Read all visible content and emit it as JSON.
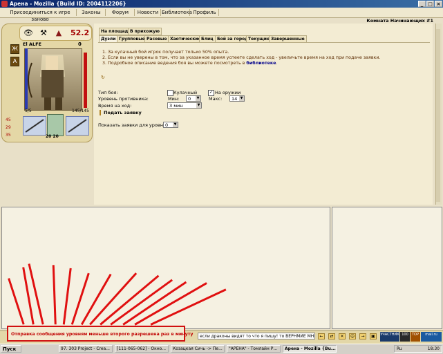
{
  "window": {
    "title": "Арена - Mozilla {Build ID: 2004112206}",
    "min_icon": "minimize-icon",
    "max_icon": "maximize-icon",
    "close_icon": "close-icon"
  },
  "menu": {
    "items": [
      "Присоединиться к игре заново",
      "Законы",
      "Форум",
      "Новости",
      "Библиотека",
      "Профиль"
    ]
  },
  "room_name": "Комната Начинающих #1",
  "player": {
    "level": "52.2",
    "nick": "El ALFE",
    "nick_value": "0",
    "hp": "5/5",
    "mp": "145/145",
    "side_labels": [
      "Ж",
      "А"
    ],
    "stats": [
      "45",
      "29",
      "35"
    ],
    "ammo": "20  20",
    "icons": [
      "eye-icon",
      "tools-icon",
      "wizard-hat-icon"
    ]
  },
  "tabs_top": [
    "На площадь",
    "В прихожую"
  ],
  "tabs_fight": [
    "Дуэли",
    "Групповые",
    "Расовые",
    "Хаотические",
    "Блиц",
    "Бой за город",
    "Текущие",
    "Завершенные"
  ],
  "active_fight_tab": "Дуэли",
  "rules": {
    "line1": "1.  За кулачный бой игрок получает только 50% опыта.",
    "line2": "2.  Если вы не уверены в том, что за указанное время успеете сделать ход - увеличьте время на ход при подаче заявки.",
    "line3_prefix": "3.  Подробное описание ведения боя вы можете посмотреть в ",
    "line3_link": "библиотеке",
    "line3_suffix": "."
  },
  "refresh_symbol": "↻",
  "form": {
    "fight_type_label": "Тип боя:",
    "fist_label": "Кулачный",
    "weapon_label": "На оружии",
    "opponent_level_label": "Уровень противника:",
    "min_label": "Мин:",
    "min_value": "0",
    "max_label": "Макс:",
    "max_value": "14",
    "turn_time_label": "Время на ход:",
    "turn_time_value": "3 мин",
    "submit_label": "Подать заявку",
    "show_level_label": "Показать заявки для уровня:",
    "show_level_value": "0"
  },
  "chat": {
    "notice": "Отправка сообщения уровням меньше второго разрешена раз в минуту",
    "input_value": "если драконы видят то что я пишу! то ВЕРНМИЕ МНЕ УРОВЕНЬ",
    "buttons": [
      "←",
      "⇄",
      "✕",
      "☺",
      "→",
      "▣"
    ],
    "badges": [
      "УЧАСТНИК",
      "100",
      "TOP",
      "mail.ru"
    ]
  },
  "taskbar": {
    "start_label": "Пуск",
    "tasks": [
      "97. 303 Project - Crea...",
      "[111-065-062] - Окно...",
      "Козацкая Сичь -> Пе...",
      "\"АРЕНА\" - Томлайн Р...",
      "Арена - Mozilla {Bu..."
    ],
    "active_task": 4,
    "lang": "Ru",
    "clock": "18:30"
  }
}
